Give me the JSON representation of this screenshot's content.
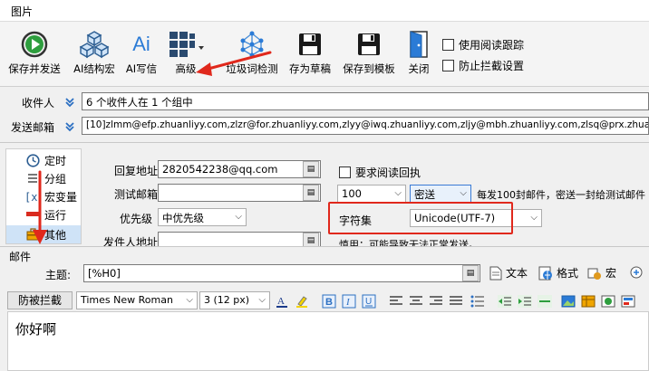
{
  "window": {
    "title": "图片"
  },
  "toolbar": {
    "save_send": "保存并发送",
    "ai_struct": "AI结构宏",
    "ai_write": "AI写信",
    "advanced": "高级",
    "spam_check": "垃圾词检测",
    "save_draft": "存为草稿",
    "save_template": "保存到模板",
    "close": "关闭",
    "read_tracking": "使用阅读跟踪",
    "anti_block": "防止拦截设置",
    "ai_icon_text": "Ai"
  },
  "recipients": {
    "label": "收件人",
    "value": "6 个收件人在 1 个组中"
  },
  "sender": {
    "label": "发送邮箱",
    "value": "[10]zlmm@efp.zhuanliyy.com,zlzr@for.zhuanliyy.com,zlyy@iwq.zhuanliyy.com,zljy@mbh.zhuanliyy.com,zlsq@prx.zhuanliyy.com,"
  },
  "sidebar": {
    "items": [
      {
        "label": "定时"
      },
      {
        "label": "分组"
      },
      {
        "label": "宏变量"
      },
      {
        "label": "运行"
      },
      {
        "label": "其他"
      }
    ]
  },
  "form": {
    "reply_label": "回复地址",
    "reply_value": "2820542238@qq.com",
    "test_label": "测试邮箱",
    "test_value": "",
    "priority_label": "优先级",
    "priority_value": "中优先级",
    "sender_addr_label": "发件人地址",
    "read_receipt_label": "要求阅读回执",
    "count_value": "100",
    "send_mode_value": "密送",
    "per_note": "每发100封邮件，密送一封给测试邮件",
    "charset_label": "字符集",
    "charset_value": "Unicode(UTF-7)",
    "note_text": "慎用：可能导致无法正常发送。"
  },
  "mail": {
    "section_label": "邮件",
    "subject_label": "主题:",
    "subject_value": "[%H0]",
    "text_btn": "文本",
    "format_btn": "格式",
    "macro_btn": "宏",
    "anti_block_btn": "防被拦截",
    "font_name": "Times New Roman",
    "font_size": "3 (12 px)",
    "body_text": "你好啊"
  },
  "colors": {
    "accent_red": "#e0281c",
    "blue_icon": "#2b7bd6",
    "green_icon": "#2e9e3e"
  }
}
